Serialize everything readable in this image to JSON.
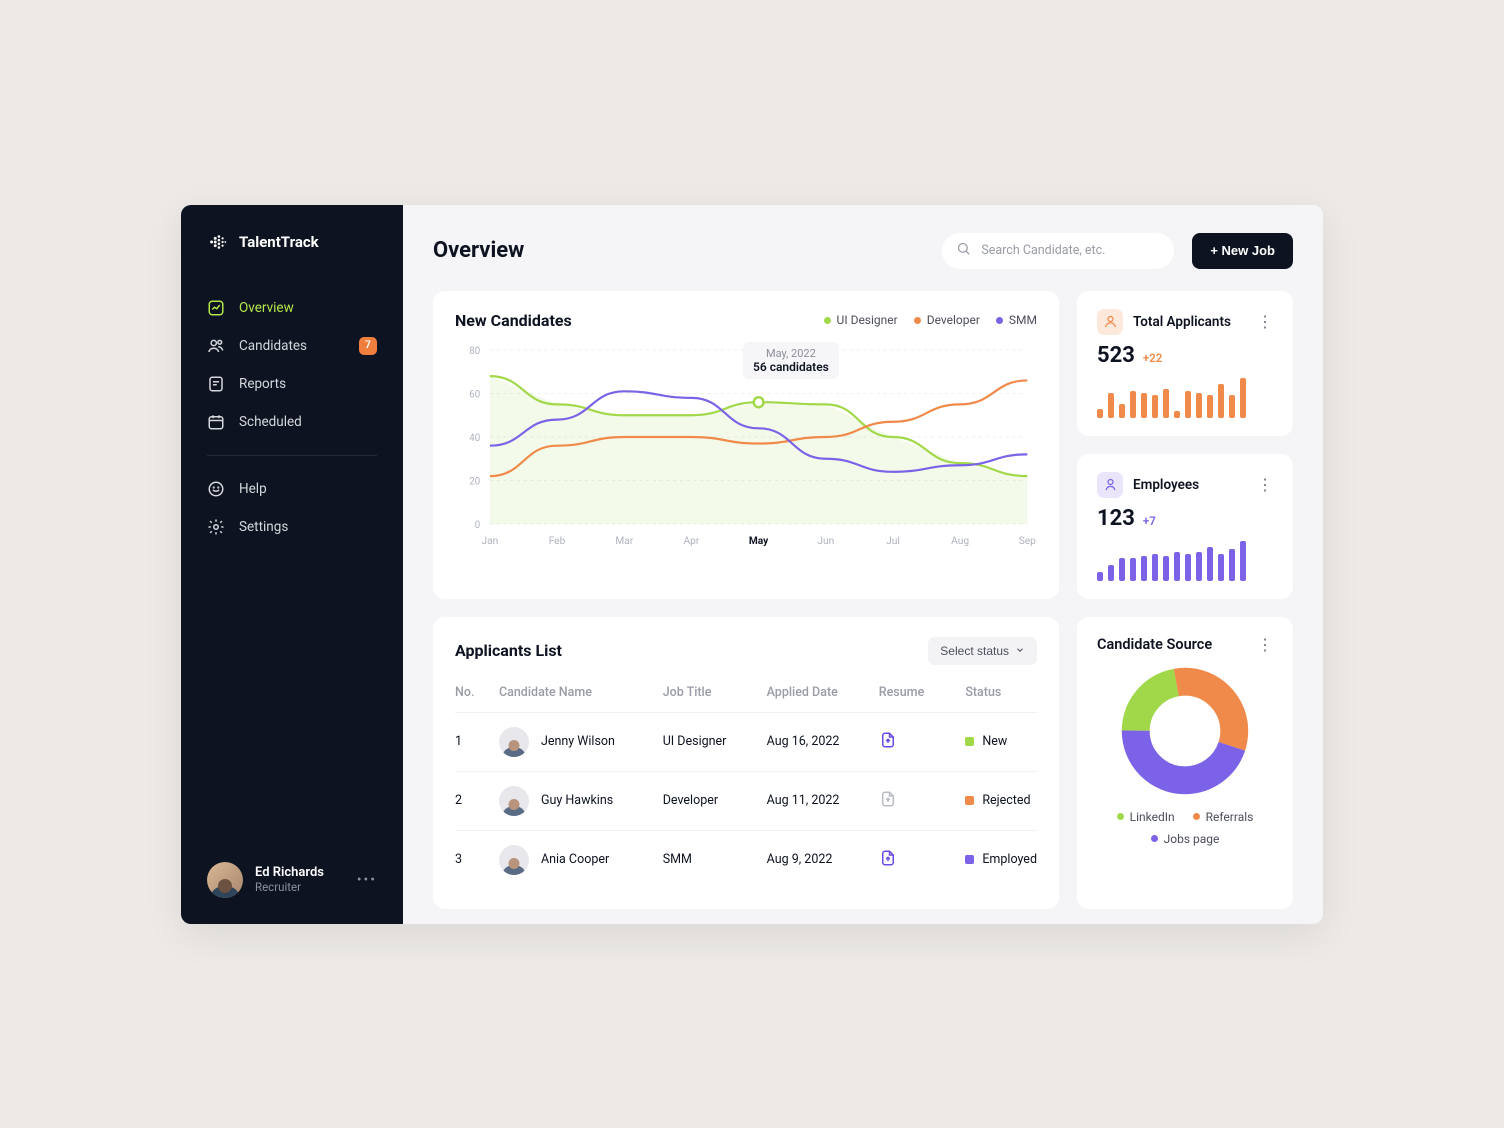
{
  "brand": {
    "name": "TalentTrack"
  },
  "sidebar": {
    "items": [
      {
        "label": "Overview"
      },
      {
        "label": "Candidates",
        "badge": "7"
      },
      {
        "label": "Reports"
      },
      {
        "label": "Scheduled"
      }
    ],
    "secondary": [
      {
        "label": "Help"
      },
      {
        "label": "Settings"
      }
    ]
  },
  "user": {
    "name": "Ed Richards",
    "role": "Recruiter"
  },
  "header": {
    "title": "Overview",
    "search_placeholder": "Search Candidate, etc.",
    "new_job": "+ New Job"
  },
  "chart": {
    "title": "New Candidates",
    "legend": {
      "ui": "UI Designer",
      "dev": "Developer",
      "smm": "SMM"
    },
    "tooltip": {
      "date": "May, 2022",
      "value": "56 candidates"
    },
    "y_ticks": [
      "80",
      "60",
      "40",
      "20",
      "0"
    ]
  },
  "chart_data": {
    "type": "line",
    "categories": [
      "Jan",
      "Feb",
      "Mar",
      "Apr",
      "May",
      "Jun",
      "Jul",
      "Aug",
      "Sep"
    ],
    "ylim": [
      0,
      80
    ],
    "series": [
      {
        "name": "UI Designer",
        "color": "#a1d84a",
        "values": [
          68,
          55,
          50,
          50,
          56,
          55,
          40,
          28,
          22
        ]
      },
      {
        "name": "Developer",
        "color": "#f08a4a",
        "values": [
          22,
          36,
          40,
          40,
          37,
          40,
          47,
          55,
          66
        ]
      },
      {
        "name": "SMM",
        "color": "#7b62e6",
        "values": [
          36,
          48,
          61,
          58,
          44,
          30,
          24,
          27,
          32
        ]
      }
    ]
  },
  "stats": {
    "applicants": {
      "title": "Total Applicants",
      "value": "523",
      "delta": "+22",
      "bars": [
        8,
        22,
        12,
        24,
        22,
        20,
        26,
        6,
        24,
        22,
        20,
        30,
        20,
        36
      ]
    },
    "employees": {
      "title": "Employees",
      "value": "123",
      "delta": "+7",
      "bars": [
        8,
        14,
        20,
        20,
        22,
        24,
        22,
        26,
        24,
        26,
        30,
        24,
        28,
        36
      ]
    }
  },
  "table": {
    "title": "Applicants List",
    "select": "Select status",
    "cols": {
      "no": "No.",
      "name": "Candidate Name",
      "job": "Job Title",
      "date": "Applied Date",
      "resume": "Resume",
      "status": "Status"
    },
    "rows": [
      {
        "no": "1",
        "name": "Jenny Wilson",
        "job": "UI Designer",
        "date": "Aug 16, 2022",
        "status": "New",
        "statusColor": "sgreen",
        "resumeColor": "#6a4ae0"
      },
      {
        "no": "2",
        "name": "Guy Hawkins",
        "job": "Developer",
        "date": "Aug 11, 2022",
        "status": "Rejected",
        "statusColor": "sorange",
        "resumeColor": "#b9bcc7"
      },
      {
        "no": "3",
        "name": "Ania Cooper",
        "job": "SMM",
        "date": "Aug 9, 2022",
        "status": "Employed",
        "statusColor": "spurple",
        "resumeColor": "#6a4ae0"
      }
    ]
  },
  "source": {
    "title": "Candidate Source",
    "legend": {
      "linkedin": "LinkedIn",
      "referrals": "Referrals",
      "jobs": "Jobs page"
    }
  },
  "donut_data": {
    "type": "pie",
    "slices": [
      {
        "label": "LinkedIn",
        "value": 22,
        "color": "#a1d84a"
      },
      {
        "label": "Referrals",
        "value": 33,
        "color": "#f08a4a"
      },
      {
        "label": "Jobs page",
        "value": 45,
        "color": "#7b62e6"
      }
    ]
  }
}
